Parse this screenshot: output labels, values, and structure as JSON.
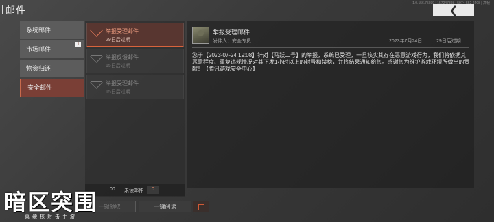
{
  "header": {
    "title": "邮件",
    "version": "1.0.156.75039 | 157247898 | 5974-552 2408 | 高帧",
    "back_icon": "chevron-left-icon"
  },
  "sidebar": {
    "items": [
      {
        "label": "系统邮件",
        "active": false
      },
      {
        "label": "市场邮件",
        "active": false,
        "badge": "1"
      },
      {
        "label": "物资归还",
        "active": false
      },
      {
        "label": "安全邮件",
        "active": true
      }
    ]
  },
  "mail_list": {
    "items": [
      {
        "title": "举报受理邮件",
        "expire": "29日后过期",
        "active": true
      },
      {
        "title": "举报反馈邮件",
        "expire": "15日后过期",
        "active": false
      },
      {
        "title": "举报受理邮件",
        "expire": "15日后过期",
        "active": false
      }
    ],
    "total": "00",
    "unread_label": "未读邮件",
    "unread_count": "0"
  },
  "content": {
    "title": "举报受理邮件",
    "sender": "发件人：安全专员",
    "date": "2023年7月24日",
    "expire": "29日后过期",
    "body": "您于【2023-07-24 19:08】针对【马跃二号】的举报，系统已受理，一旦核实其存在恶意游戏行为，我们将依据其恶意程度、重复违规情况对其下发1小时以上的封号和禁榜，并将结果通知给您。感谢您为维护游戏环境所做出的贡献！【腾讯游戏安全中心】"
  },
  "footer": {
    "claim_label": "一键领取",
    "read_label": "一键阅读",
    "delete_icon": "trash-icon"
  },
  "watermark": {
    "logo_text": "暗区突围",
    "slogan": "真硬核射击手游"
  },
  "colors": {
    "accent": "#d8633c",
    "active_sidebar": "#7a3f36"
  }
}
